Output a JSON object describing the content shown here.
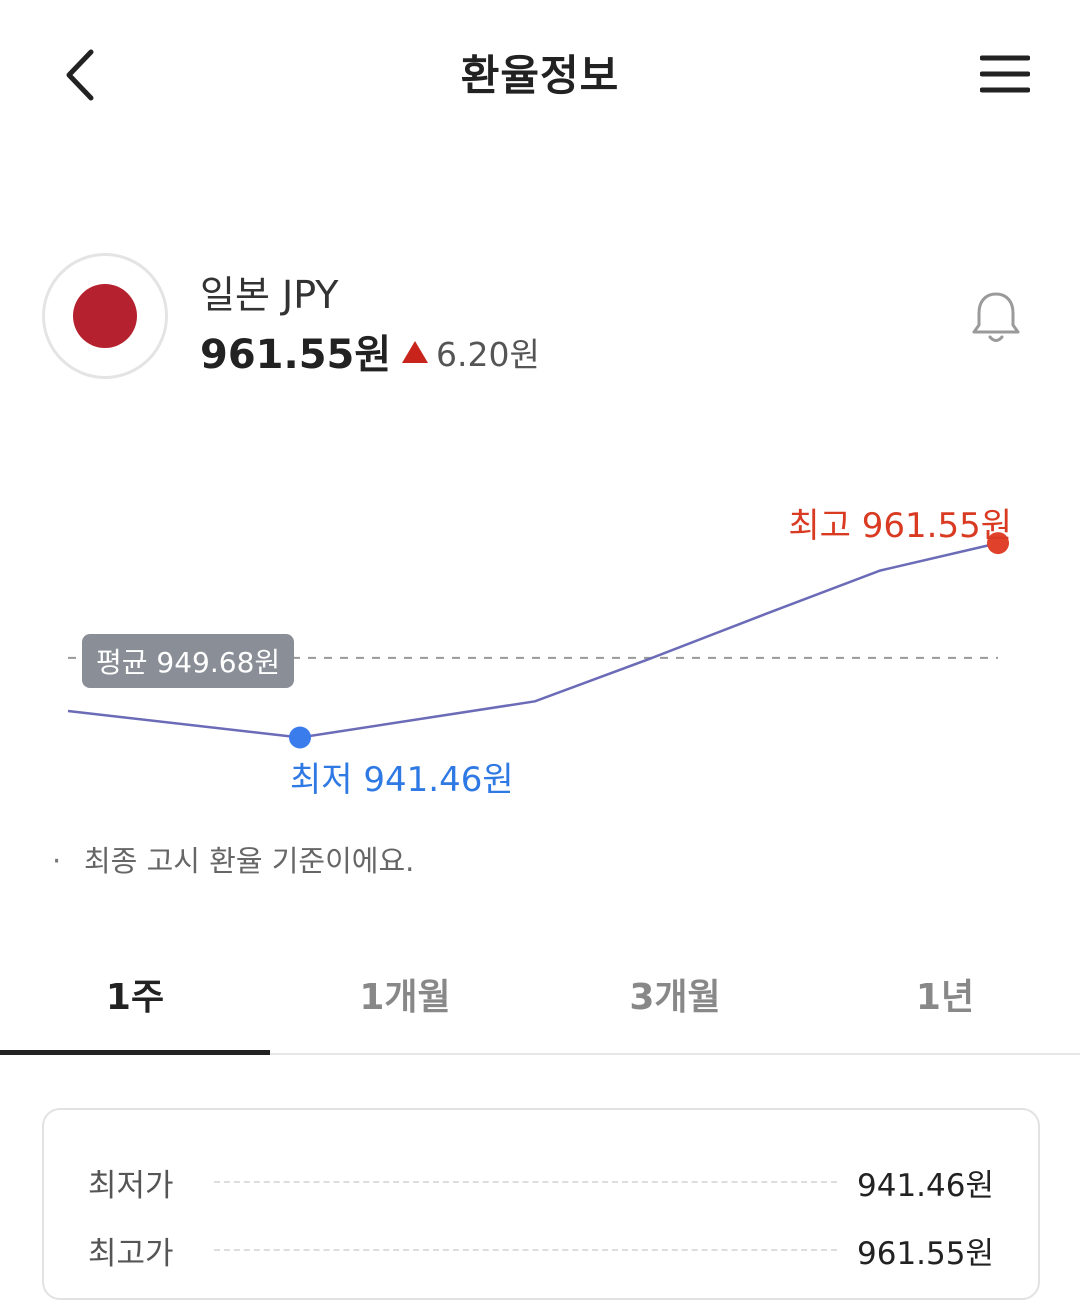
{
  "header": {
    "title": "환율정보",
    "icons": [
      "chevron-left-icon",
      "hamburger-menu-icon"
    ]
  },
  "currency": {
    "name": "일본 JPY",
    "flag_icon": "japan-flag-icon",
    "rate": "961.55원",
    "change": "6.20원",
    "change_direction": "up",
    "change_color": "#c8241c",
    "alert_icon": "bell-icon"
  },
  "chart_data": {
    "type": "line",
    "x": [
      1,
      2,
      3,
      4,
      5,
      6,
      7
    ],
    "values": [
      944.2,
      941.46,
      945.2,
      949.6,
      954.2,
      958.7,
      961.55
    ],
    "ylim": [
      935,
      966
    ],
    "average": 949.68,
    "high_label": "최고 961.55원",
    "low_label": "최저 941.46원",
    "avg_label": "평균 949.68원",
    "line_color": "#6b6bb8",
    "high_color": "#e0412a",
    "low_color": "#3b7cec",
    "grid": false
  },
  "note": "최종 고시 환율 기준이에요.",
  "tabs": [
    {
      "label": "1주",
      "active": true
    },
    {
      "label": "1개월",
      "active": false
    },
    {
      "label": "3개월",
      "active": false
    },
    {
      "label": "1년",
      "active": false
    }
  ],
  "summary": {
    "low_label": "최저가",
    "low_value": "941.46원",
    "high_label": "최고가",
    "high_value": "961.55원"
  }
}
